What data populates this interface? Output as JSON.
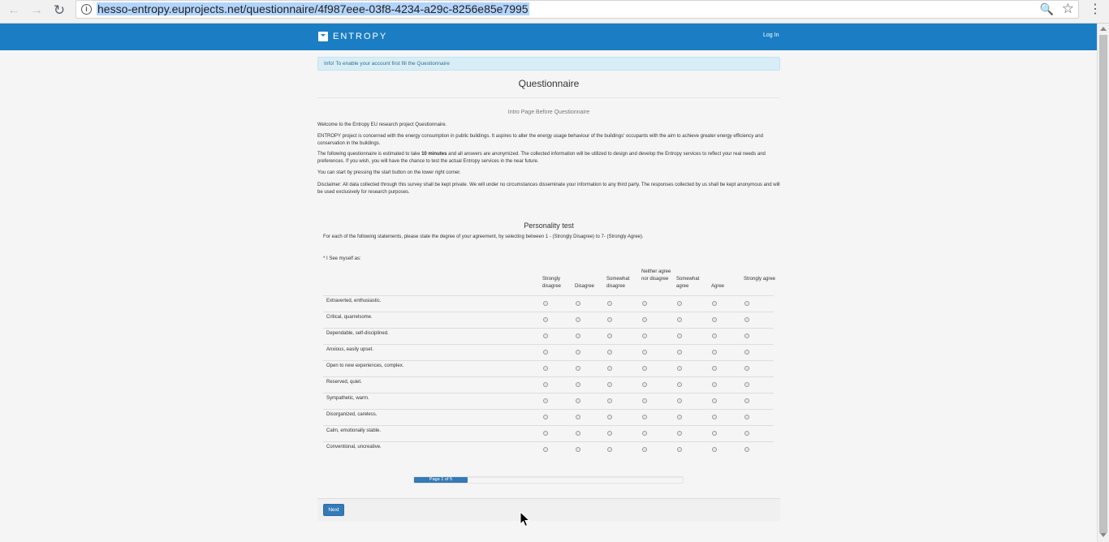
{
  "browser": {
    "url": "hesso-entropy.euprojects.net/questionnaire/4f987eee-03f8-4234-a29c-8256e85e7995",
    "back_icon": "arrow-left",
    "forward_icon": "arrow-right",
    "reload_icon": "reload",
    "info_icon": "info",
    "zoom_icon": "magnifier",
    "star_icon": "star",
    "menu_icon": "kebab-menu"
  },
  "navbar": {
    "brand": "ENTROPY",
    "login": "Log In",
    "color": "#1b7ec4"
  },
  "alert": {
    "text": "Info! To enable your account first fill the Questionnaire"
  },
  "page": {
    "title": "Questionnaire",
    "intro_title": "Intro Page Before Questionnaire",
    "paragraphs": {
      "p1": "Welcome to the Entropy EU research project Questionnaire.",
      "p2": "ENTROPY project is concerned with the energy consumption in public buildings. It aspires to alter the energy usage behaviour of the buildings' occupants with the aim to achieve greater energy efficiency and conservation in the buildings.",
      "p3_before": "The following questionnaire is estimated to take ",
      "p3_bold": "10 minutes",
      "p3_after": " and all answers are anonymized. The collected information will be utilized to design and develop the Entropy services to reflect your real needs and preferences. If you wish, you will have the chance to test the actual Entropy services in the near future.",
      "p4": "You can start by pressing the start button on the lower right corner.",
      "p5": "Disclaimer: All data collected through this survey shall be kept private. We will under no circumstances disseminate your information to any third party. The responses collected by us shall be kept anonymous and will be used exclusively for research purposes."
    }
  },
  "personality": {
    "title": "Personality test",
    "instructions": "For each of the following statements, please state the degree of your agreement, by selecting between 1 - (Strongly Disagree) to 7- (Strongly Agree).",
    "question": "* I See myself as:",
    "columns": [
      "Strongly disagree",
      "Disagree",
      "Somewhat disagree",
      "Neither agree nor disagree",
      "Somewhat agree",
      "Agree",
      "Strongly agree"
    ],
    "rows": [
      "Extraverted, enthusiastic.",
      "Critical, quarrelsome.",
      "Dependable, self-disciplined.",
      "Anxious, easily upset.",
      "Open to new experiences, complex.",
      "Reserved, quiet.",
      "Sympathetic, warm.",
      "Disorganized, careless.",
      "Calm, emotionally stable.",
      "Conventional, uncreative."
    ]
  },
  "progress": {
    "label": "Page 1 of 5",
    "fraction": 0.2,
    "color": "#337ab7"
  },
  "footer": {
    "next_label": "Next"
  }
}
